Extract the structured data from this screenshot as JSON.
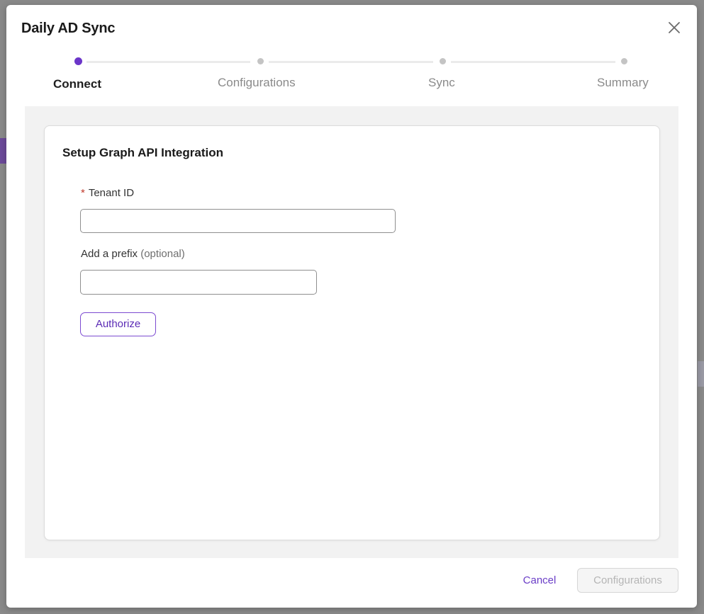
{
  "modal": {
    "title": "Daily AD Sync"
  },
  "stepper": {
    "steps": [
      {
        "label": "Connect",
        "active": true
      },
      {
        "label": "Configurations",
        "active": false
      },
      {
        "label": "Sync",
        "active": false
      },
      {
        "label": "Summary",
        "active": false
      }
    ]
  },
  "form": {
    "card_title": "Setup Graph API Integration",
    "tenant": {
      "required_mark": "*",
      "label": "Tenant ID",
      "value": ""
    },
    "prefix": {
      "label": "Add a prefix",
      "optional": "(optional)",
      "value": ""
    },
    "authorize_label": "Authorize"
  },
  "footer": {
    "cancel_label": "Cancel",
    "next_label": "Configurations"
  },
  "colors": {
    "accent": "#6b35c9",
    "required": "#c0392b",
    "inactive_step": "#c4c4c4",
    "content_bg": "#f2f2f2"
  },
  "icons": {
    "close": "close-icon"
  }
}
